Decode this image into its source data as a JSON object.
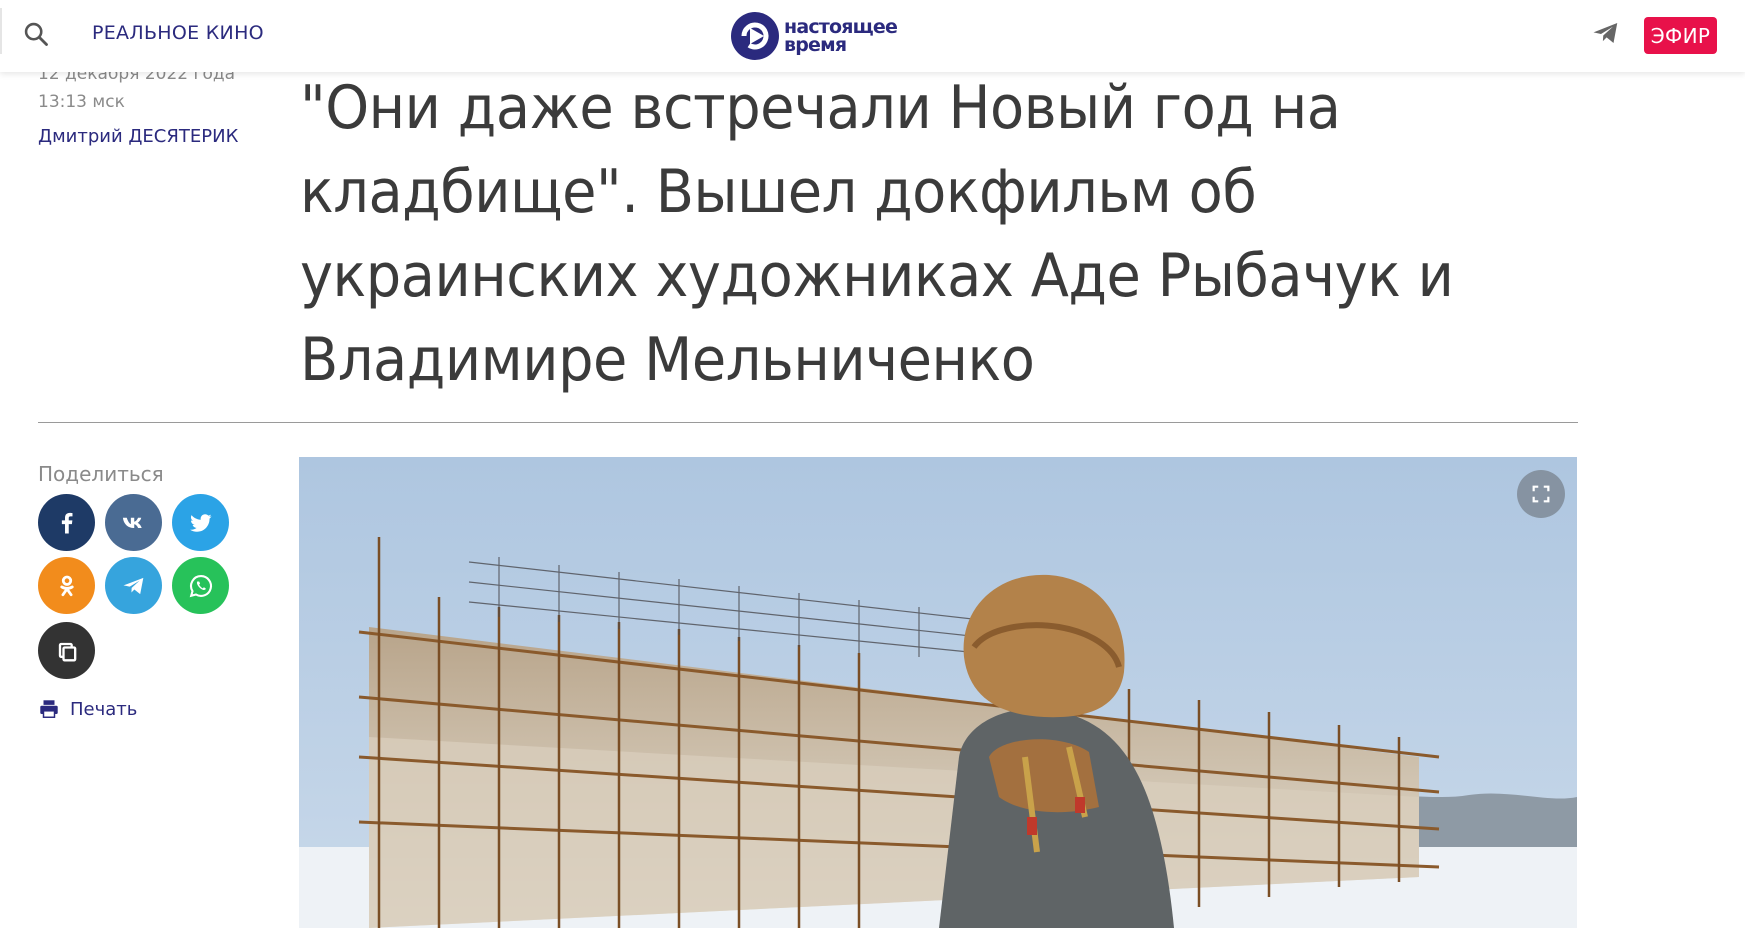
{
  "header": {
    "section_link": "РЕАЛЬНОЕ КИНО",
    "logo": {
      "line1": "настоящее",
      "line2": "время"
    },
    "live_label": "ЭФИР"
  },
  "article": {
    "date": "12 декабря 2022 года",
    "time": "13:13 мск",
    "author": "Дмитрий ДЕСЯТЕРИК",
    "title": "\"Они даже встречали Новый год на кладбище\". Вышел докфильм об украинских художниках Аде Рыбачук и Владимире Мельниченко"
  },
  "share": {
    "label": "Поделиться",
    "buttons": [
      {
        "name": "facebook",
        "icon": "facebook-icon",
        "color": "#1e3a66"
      },
      {
        "name": "vk",
        "icon": "vk-icon",
        "color": "#4a6b93"
      },
      {
        "name": "twitter",
        "icon": "twitter-icon",
        "color": "#2ba3e6"
      },
      {
        "name": "odnoklassniki",
        "icon": "odnoklassniki-icon",
        "color": "#f28c1c"
      },
      {
        "name": "telegram",
        "icon": "telegram-icon",
        "color": "#36a4dd"
      },
      {
        "name": "whatsapp",
        "icon": "whatsapp-icon",
        "color": "#27c25a"
      },
      {
        "name": "copy-link",
        "icon": "copy-icon",
        "color": "#333333"
      }
    ],
    "print_label": "Печать"
  },
  "colors": {
    "brand": "#2b2a7e",
    "live": "#e8114a"
  }
}
